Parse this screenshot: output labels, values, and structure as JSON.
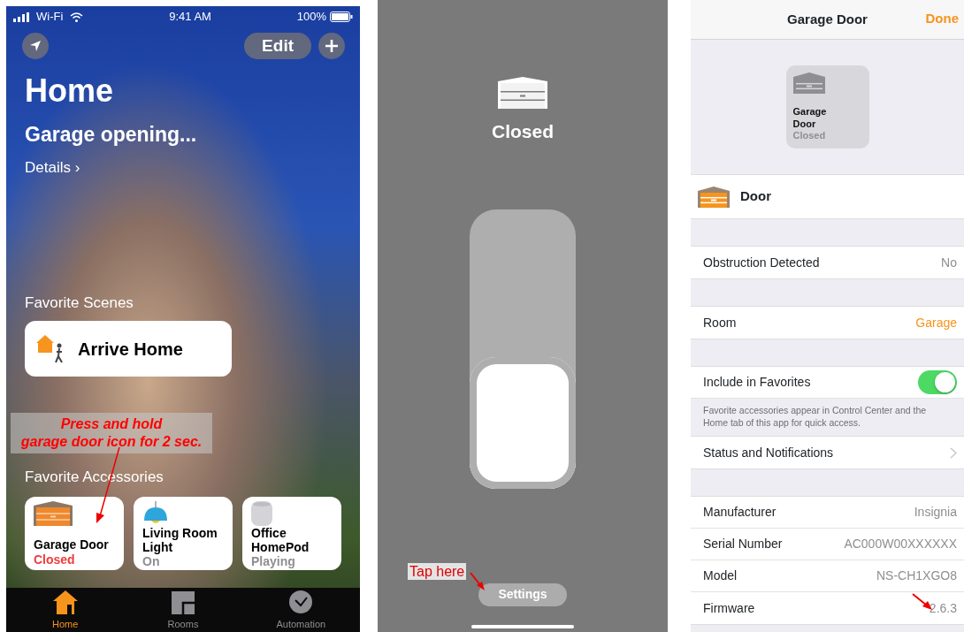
{
  "home_screen": {
    "status_bar": {
      "carrier": "Wi-Fi",
      "time": "9:41 AM",
      "battery": "100%"
    },
    "edit_button": "Edit",
    "title": "Home",
    "status": "Garage opening...",
    "details_link": "Details ›",
    "scenes_heading": "Favorite Scenes",
    "scenes": [
      {
        "name": "Arrive Home"
      }
    ],
    "annotation_lines": [
      "Press and hold",
      "garage door icon for 2 sec."
    ],
    "accessories_heading": "Favorite Accessories",
    "accessories": [
      {
        "kind": "garage",
        "name": "Garage Door",
        "status": "Closed",
        "alert": true
      },
      {
        "kind": "lamp",
        "name": "Living Room Light",
        "status": "On",
        "alert": false
      },
      {
        "kind": "speaker",
        "name": "Office HomePod",
        "status": "Playing",
        "alert": false
      }
    ],
    "tabs": [
      {
        "kind": "home",
        "label": "Home",
        "selected": true
      },
      {
        "kind": "rooms",
        "label": "Rooms",
        "selected": false
      },
      {
        "kind": "automation",
        "label": "Automation",
        "selected": false
      }
    ]
  },
  "control_screen": {
    "status": "Closed",
    "level": 0.47,
    "annotation": "Tap here",
    "settings_button": "Settings"
  },
  "settings_screen": {
    "title": "Garage Door",
    "done_button": "Done",
    "tile": {
      "name": "Garage Door",
      "status": "Closed"
    },
    "service": "Door",
    "groups": [
      {
        "rows": [
          {
            "kind": "value",
            "label": "Obstruction Detected",
            "value": "No",
            "accent": false
          }
        ]
      },
      {
        "rows": [
          {
            "kind": "value",
            "label": "Room",
            "value": "Garage",
            "accent": true
          }
        ]
      },
      {
        "rows": [
          {
            "kind": "toggle",
            "label": "Include in Favorites",
            "on": true
          }
        ],
        "footer": "Favorite accessories appear in Control Center and the Home tab of this app for quick access."
      },
      {
        "rows": [
          {
            "kind": "link",
            "label": "Status and Notifications"
          }
        ]
      },
      {
        "rows": [
          {
            "kind": "value",
            "label": "Manufacturer",
            "value": "Insignia",
            "accent": false
          },
          {
            "kind": "value",
            "label": "Serial Number",
            "value": "AC000W00XXXXXX",
            "accent": false
          },
          {
            "kind": "value",
            "label": "Model",
            "value": "NS-CH1XGO8",
            "accent": false
          },
          {
            "kind": "value",
            "label": "Firmware",
            "value": "2.6.3",
            "accent": false
          }
        ]
      }
    ]
  }
}
